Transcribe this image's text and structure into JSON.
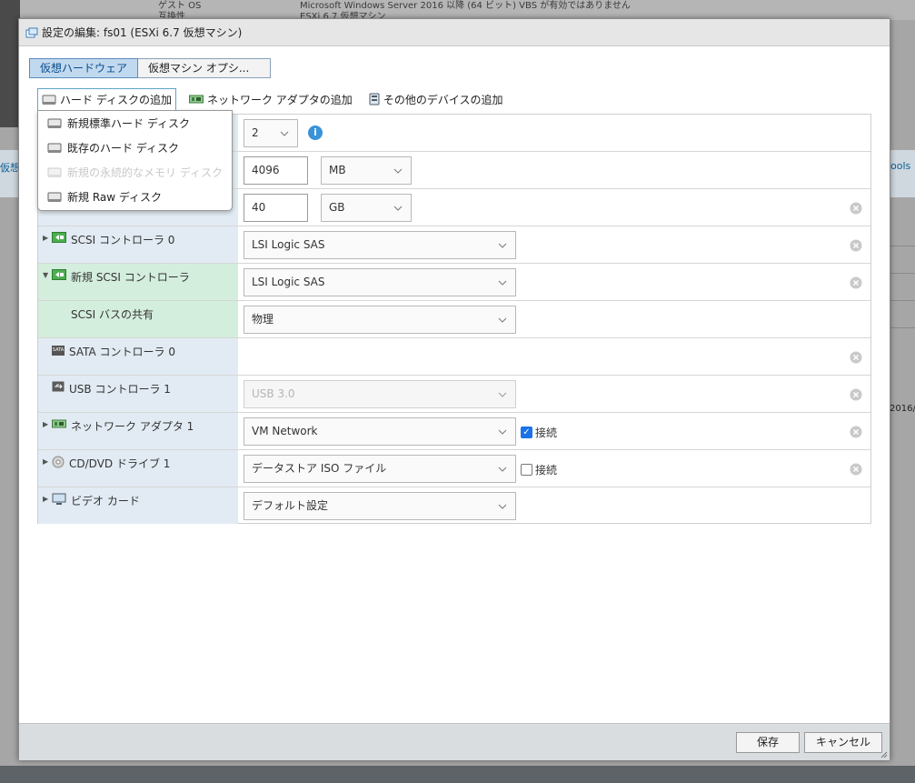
{
  "background": {
    "line1": "ゲスト OS",
    "line1_value": "Microsoft Windows Server 2016 以降 (64 ビット) VBS が有効ではありません",
    "line2": "互換性",
    "line2_value": "ESXi 6.7 仮想マシン",
    "left_partial": "仮想",
    "right_partial": "ools",
    "right_date": "2016/"
  },
  "dialog": {
    "title": "設定の編集: fs01 (ESXi 6.7 仮想マシン)",
    "tabs": [
      {
        "label": "仮想ハードウェア",
        "active": true
      },
      {
        "label": "仮想マシン オプシ...",
        "active": false
      }
    ],
    "add_actions": {
      "hard_disk": "ハード ディスクの追加",
      "network": "ネットワーク アダプタの追加",
      "other": "その他のデバイスの追加"
    },
    "add_menu": [
      {
        "label": "新規標準ハード ディスク",
        "enabled": true
      },
      {
        "label": "既存のハード ディスク",
        "enabled": true
      },
      {
        "label": "新規の永続的なメモリ ディスク",
        "enabled": false
      },
      {
        "label": "新規 Raw ディスク",
        "enabled": true
      }
    ],
    "rows": {
      "cpu": {
        "value": "2"
      },
      "memory": {
        "value": "4096",
        "unit": "MB"
      },
      "disk": {
        "value": "40",
        "unit": "GB"
      },
      "scsi0": {
        "label": "SCSI コントローラ 0",
        "value": "LSI Logic SAS"
      },
      "new_scsi": {
        "label": "新規 SCSI コントローラ",
        "value": "LSI Logic SAS"
      },
      "bus_share": {
        "label": "SCSI バスの共有",
        "value": "物理"
      },
      "sata0": {
        "label": "SATA コントローラ 0"
      },
      "usb1": {
        "label": "USB コントローラ 1",
        "value": "USB 3.0"
      },
      "nic1": {
        "label": "ネットワーク アダプタ 1",
        "value": "VM Network",
        "connect_label": "接続",
        "connected": true
      },
      "cd1": {
        "label": "CD/DVD ドライブ 1",
        "value": "データストア ISO ファイル",
        "connect_label": "接続",
        "connected": false
      },
      "video": {
        "label": "ビデオ カード",
        "value": "デフォルト設定"
      }
    },
    "icon_text": {
      "sata": "SATA"
    },
    "footer": {
      "save": "保存",
      "cancel": "キャンセル"
    }
  },
  "colors": {
    "tab_active_bg": "#c1d9ef",
    "label_bg": "#e2ebf3",
    "label_green_bg": "#d4eedd",
    "info_blue": "#3a93d8",
    "checkbox_blue": "#1a73e8"
  },
  "icons": [
    "vm-icon",
    "hard-disk-icon",
    "network-adapter-icon",
    "device-icon",
    "info-icon",
    "scsi-controller-icon",
    "sata-icon",
    "usb-icon",
    "cd-dvd-icon",
    "monitor-icon",
    "remove-icon",
    "chevron-down-icon",
    "expand-arrow-icon",
    "resize-grip-icon"
  ]
}
